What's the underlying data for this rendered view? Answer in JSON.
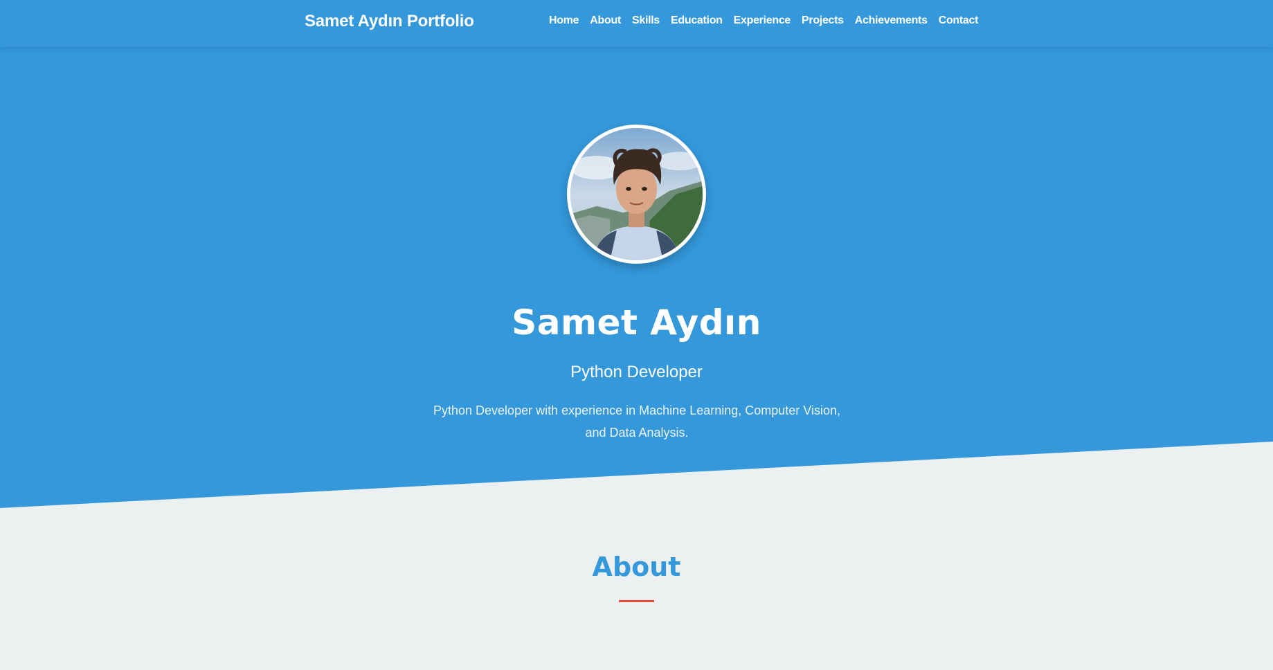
{
  "navbar": {
    "brand": "Samet Aydın Portfolio",
    "links": [
      "Home",
      "About",
      "Skills",
      "Education",
      "Experience",
      "Projects",
      "Achievements",
      "Contact"
    ]
  },
  "hero": {
    "name": "Samet Aydın",
    "title": "Python Developer",
    "description": "Python Developer with experience in Machine Learning, Computer Vision, and Data Analysis."
  },
  "about": {
    "title": "About"
  },
  "colors": {
    "primary": "#3498db",
    "background": "#ecf0f1",
    "accent": "#e74c3c",
    "text_light": "#ffffff"
  },
  "icons": {
    "avatar": "profile-photo"
  }
}
